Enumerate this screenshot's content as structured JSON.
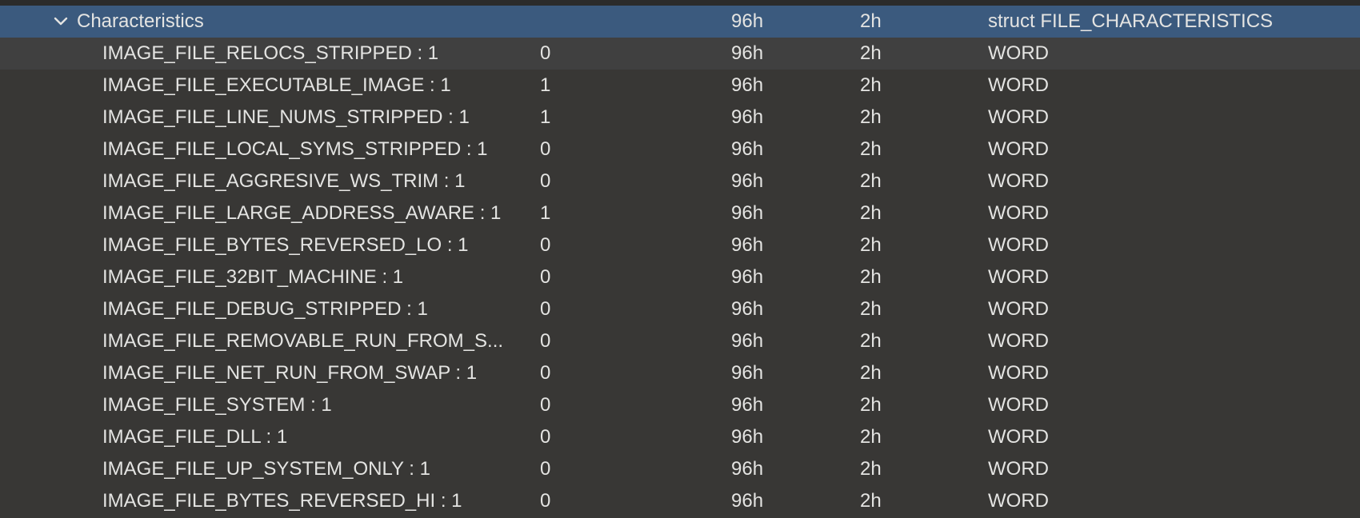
{
  "parent": {
    "name": "Characteristics",
    "value": "",
    "start": "96h",
    "size": "2h",
    "type": "struct FILE_CHARACTERISTICS",
    "expanded_icon": "chevron-down-icon"
  },
  "rows": [
    {
      "name": "IMAGE_FILE_RELOCS_STRIPPED : 1",
      "value": "0",
      "start": "96h",
      "size": "2h",
      "type": "WORD"
    },
    {
      "name": "IMAGE_FILE_EXECUTABLE_IMAGE : 1",
      "value": "1",
      "start": "96h",
      "size": "2h",
      "type": "WORD"
    },
    {
      "name": "IMAGE_FILE_LINE_NUMS_STRIPPED : 1",
      "value": "1",
      "start": "96h",
      "size": "2h",
      "type": "WORD"
    },
    {
      "name": "IMAGE_FILE_LOCAL_SYMS_STRIPPED : 1",
      "value": "0",
      "start": "96h",
      "size": "2h",
      "type": "WORD"
    },
    {
      "name": "IMAGE_FILE_AGGRESIVE_WS_TRIM : 1",
      "value": "0",
      "start": "96h",
      "size": "2h",
      "type": "WORD"
    },
    {
      "name": "IMAGE_FILE_LARGE_ADDRESS_AWARE : 1",
      "value": "1",
      "start": "96h",
      "size": "2h",
      "type": "WORD"
    },
    {
      "name": "IMAGE_FILE_BYTES_REVERSED_LO : 1",
      "value": "0",
      "start": "96h",
      "size": "2h",
      "type": "WORD"
    },
    {
      "name": "IMAGE_FILE_32BIT_MACHINE : 1",
      "value": "0",
      "start": "96h",
      "size": "2h",
      "type": "WORD"
    },
    {
      "name": "IMAGE_FILE_DEBUG_STRIPPED : 1",
      "value": "0",
      "start": "96h",
      "size": "2h",
      "type": "WORD"
    },
    {
      "name": "IMAGE_FILE_REMOVABLE_RUN_FROM_S...",
      "value": "0",
      "start": "96h",
      "size": "2h",
      "type": "WORD"
    },
    {
      "name": "IMAGE_FILE_NET_RUN_FROM_SWAP : 1",
      "value": "0",
      "start": "96h",
      "size": "2h",
      "type": "WORD"
    },
    {
      "name": "IMAGE_FILE_SYSTEM : 1",
      "value": "0",
      "start": "96h",
      "size": "2h",
      "type": "WORD"
    },
    {
      "name": "IMAGE_FILE_DLL : 1",
      "value": "0",
      "start": "96h",
      "size": "2h",
      "type": "WORD"
    },
    {
      "name": "IMAGE_FILE_UP_SYSTEM_ONLY : 1",
      "value": "0",
      "start": "96h",
      "size": "2h",
      "type": "WORD"
    },
    {
      "name": "IMAGE_FILE_BYTES_REVERSED_HI : 1",
      "value": "0",
      "start": "96h",
      "size": "2h",
      "type": "WORD"
    }
  ],
  "colors": {
    "background": "#383735",
    "selected_row": "#3b5a7e",
    "hover_row": "#404040",
    "text": "#e4e4e2"
  }
}
